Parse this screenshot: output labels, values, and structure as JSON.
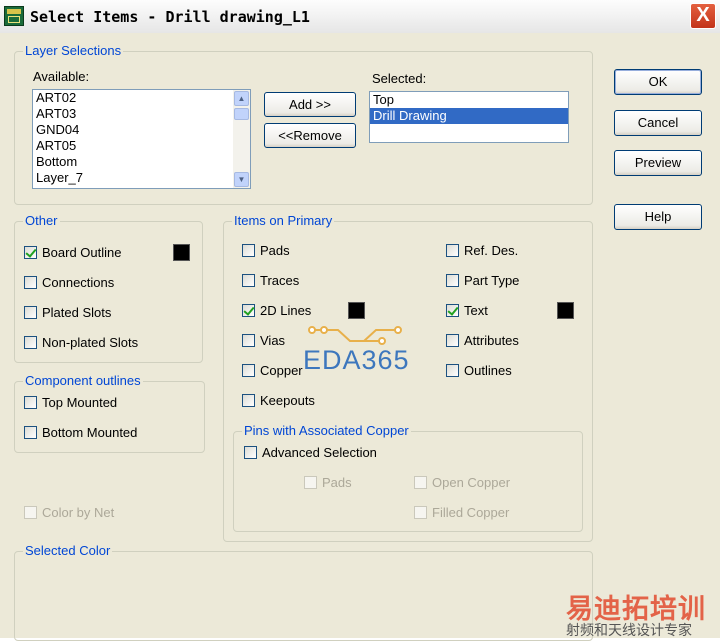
{
  "window": {
    "title": "Select Items - Drill drawing_L1",
    "close_glyph": "X",
    "app_icon": "pads-app-icon"
  },
  "layer_selections": {
    "title": "Layer Selections",
    "available_label": "Available:",
    "available_items": [
      "ART02",
      "ART03",
      "GND04",
      "ART05",
      "Bottom",
      "Layer_7"
    ],
    "selected_label": "Selected:",
    "selected_items": [
      "Top",
      "Drill Drawing"
    ],
    "add_button": "Add >>",
    "remove_button": "<<Remove"
  },
  "buttons": {
    "ok": "OK",
    "cancel": "Cancel",
    "preview": "Preview",
    "help": "Help"
  },
  "other": {
    "title": "Other",
    "items": [
      {
        "label": "Board Outline",
        "checked": true
      },
      {
        "label": "Connections",
        "checked": false
      },
      {
        "label": "Plated Slots",
        "checked": false
      },
      {
        "label": "Non-plated Slots",
        "checked": false
      }
    ]
  },
  "component_outlines": {
    "title": "Component outlines",
    "items": [
      {
        "label": "Top Mounted",
        "checked": false
      },
      {
        "label": "Bottom Mounted",
        "checked": false
      }
    ]
  },
  "color_by_net": {
    "label": "Color by Net",
    "checked": false,
    "disabled": true
  },
  "items_on_primary": {
    "title": "Items on Primary",
    "left": [
      {
        "label": "Pads",
        "checked": false
      },
      {
        "label": "Traces",
        "checked": false
      },
      {
        "label": "2D Lines",
        "checked": true
      },
      {
        "label": "Vias",
        "checked": false
      },
      {
        "label": "Copper",
        "checked": false
      },
      {
        "label": "Keepouts",
        "checked": false
      }
    ],
    "right": [
      {
        "label": "Ref. Des.",
        "checked": false
      },
      {
        "label": "Part Type",
        "checked": false
      },
      {
        "label": "Text",
        "checked": true
      },
      {
        "label": "Attributes",
        "checked": false
      },
      {
        "label": "Outlines",
        "checked": false
      }
    ]
  },
  "pins_copper": {
    "title": "Pins with Associated Copper",
    "advanced": {
      "label": "Advanced Selection",
      "checked": false
    },
    "pads": {
      "label": "Pads",
      "checked": false,
      "disabled": true
    },
    "open_copper": {
      "label": "Open Copper",
      "checked": false,
      "disabled": true
    },
    "filled_copper": {
      "label": "Filled Copper",
      "checked": false,
      "disabled": true
    }
  },
  "selected_color": {
    "title": "Selected Color"
  },
  "colors": {
    "swatch": "#000000",
    "selection": "#316ac5",
    "legend": "#0046d5"
  },
  "watermark": {
    "text": "EDA365"
  },
  "corner_logo": {
    "main": "易迪拓培训",
    "sub": "射频和天线设计专家"
  }
}
